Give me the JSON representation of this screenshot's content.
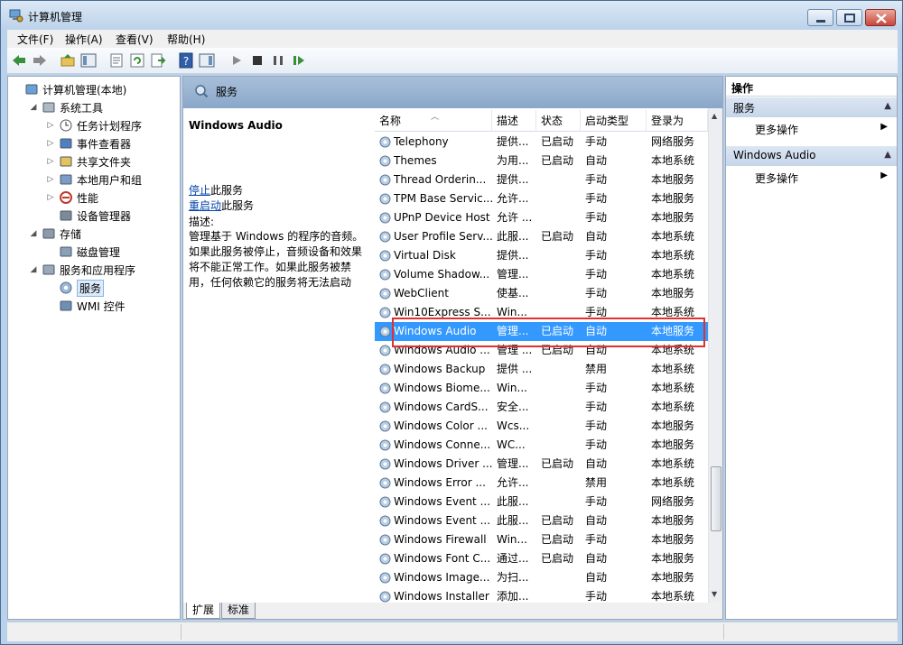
{
  "window": {
    "title": "计算机管理"
  },
  "menu": [
    "文件(F)",
    "操作(A)",
    "查看(V)",
    "帮助(H)"
  ],
  "tree": [
    {
      "label": "计算机管理(本地)",
      "icon": "computer-mgmt-icon",
      "level": 0,
      "exp": ""
    },
    {
      "label": "系统工具",
      "icon": "tools-icon",
      "level": 1,
      "exp": "◢"
    },
    {
      "label": "任务计划程序",
      "icon": "clock-icon",
      "level": 2,
      "exp": "▷"
    },
    {
      "label": "事件查看器",
      "icon": "event-viewer-icon",
      "level": 2,
      "exp": "▷"
    },
    {
      "label": "共享文件夹",
      "icon": "shared-folder-icon",
      "level": 2,
      "exp": "▷"
    },
    {
      "label": "本地用户和组",
      "icon": "users-icon",
      "level": 2,
      "exp": "▷"
    },
    {
      "label": "性能",
      "icon": "performance-icon",
      "level": 2,
      "exp": "▷"
    },
    {
      "label": "设备管理器",
      "icon": "device-manager-icon",
      "level": 2,
      "exp": ""
    },
    {
      "label": "存储",
      "icon": "storage-icon",
      "level": 1,
      "exp": "◢"
    },
    {
      "label": "磁盘管理",
      "icon": "disk-icon",
      "level": 2,
      "exp": ""
    },
    {
      "label": "服务和应用程序",
      "icon": "services-apps-icon",
      "level": 1,
      "exp": "◢"
    },
    {
      "label": "服务",
      "icon": "gear-icon",
      "level": 2,
      "exp": "",
      "selected": true
    },
    {
      "label": "WMI 控件",
      "icon": "wmi-icon",
      "level": 2,
      "exp": ""
    }
  ],
  "services_header": {
    "title": "服务"
  },
  "detail": {
    "title": "Windows Audio",
    "stop_link": "停止",
    "stop_suffix": "此服务",
    "restart_link": "重启动",
    "restart_suffix": "此服务",
    "desc_label": "描述:",
    "desc": "管理基于 Windows 的程序的音频。如果此服务被停止，音频设备和效果将不能正常工作。如果此服务被禁用，任何依赖它的服务将无法启动"
  },
  "columns": [
    "名称",
    "描述",
    "状态",
    "启动类型",
    "登录为"
  ],
  "services": [
    [
      "Telephony",
      "提供...",
      "已启动",
      "手动",
      "网络服务"
    ],
    [
      "Themes",
      "为用...",
      "已启动",
      "自动",
      "本地系统"
    ],
    [
      "Thread Orderin...",
      "提供...",
      "",
      "手动",
      "本地服务"
    ],
    [
      "TPM Base Servic...",
      "允许...",
      "",
      "手动",
      "本地服务"
    ],
    [
      "UPnP Device Host",
      "允许 ...",
      "",
      "手动",
      "本地服务"
    ],
    [
      "User Profile Serv...",
      "此服...",
      "已启动",
      "自动",
      "本地系统"
    ],
    [
      "Virtual Disk",
      "提供...",
      "",
      "手动",
      "本地系统"
    ],
    [
      "Volume Shadow...",
      "管理...",
      "",
      "手动",
      "本地系统"
    ],
    [
      "WebClient",
      "使基...",
      "",
      "手动",
      "本地服务"
    ],
    [
      "Win10Express S...",
      "Win...",
      "",
      "手动",
      "本地系统"
    ],
    [
      "Windows Audio",
      "管理...",
      "已启动",
      "自动",
      "本地服务"
    ],
    [
      "Windows Audio ...",
      "管理 ...",
      "已启动",
      "自动",
      "本地系统"
    ],
    [
      "Windows Backup",
      "提供 ...",
      "",
      "禁用",
      "本地系统"
    ],
    [
      "Windows Biome...",
      "Win...",
      "",
      "手动",
      "本地系统"
    ],
    [
      "Windows CardS...",
      "安全...",
      "",
      "手动",
      "本地系统"
    ],
    [
      "Windows Color ...",
      "Wcs...",
      "",
      "手动",
      "本地服务"
    ],
    [
      "Windows Conne...",
      "WC...",
      "",
      "手动",
      "本地服务"
    ],
    [
      "Windows Driver ...",
      "管理...",
      "已启动",
      "自动",
      "本地系统"
    ],
    [
      "Windows Error ...",
      "允许...",
      "",
      "禁用",
      "本地系统"
    ],
    [
      "Windows Event ...",
      "此服...",
      "",
      "手动",
      "网络服务"
    ],
    [
      "Windows Event ...",
      "此服...",
      "已启动",
      "自动",
      "本地服务"
    ],
    [
      "Windows Firewall",
      "Win...",
      "已启动",
      "手动",
      "本地服务"
    ],
    [
      "Windows Font C...",
      "通过...",
      "已启动",
      "自动",
      "本地服务"
    ],
    [
      "Windows Image...",
      "为扫...",
      "",
      "自动",
      "本地服务"
    ],
    [
      "Windows Installer",
      "添加...",
      "",
      "手动",
      "本地系统"
    ]
  ],
  "selected_index": 10,
  "tabs": [
    "扩展",
    "标准"
  ],
  "actions": {
    "title": "操作",
    "sections": [
      {
        "title": "服务",
        "item": "更多操作"
      },
      {
        "title": "Windows Audio",
        "item": "更多操作"
      }
    ]
  },
  "colors": {
    "selection": "#3399ff",
    "highlight_box": "#e03030"
  }
}
